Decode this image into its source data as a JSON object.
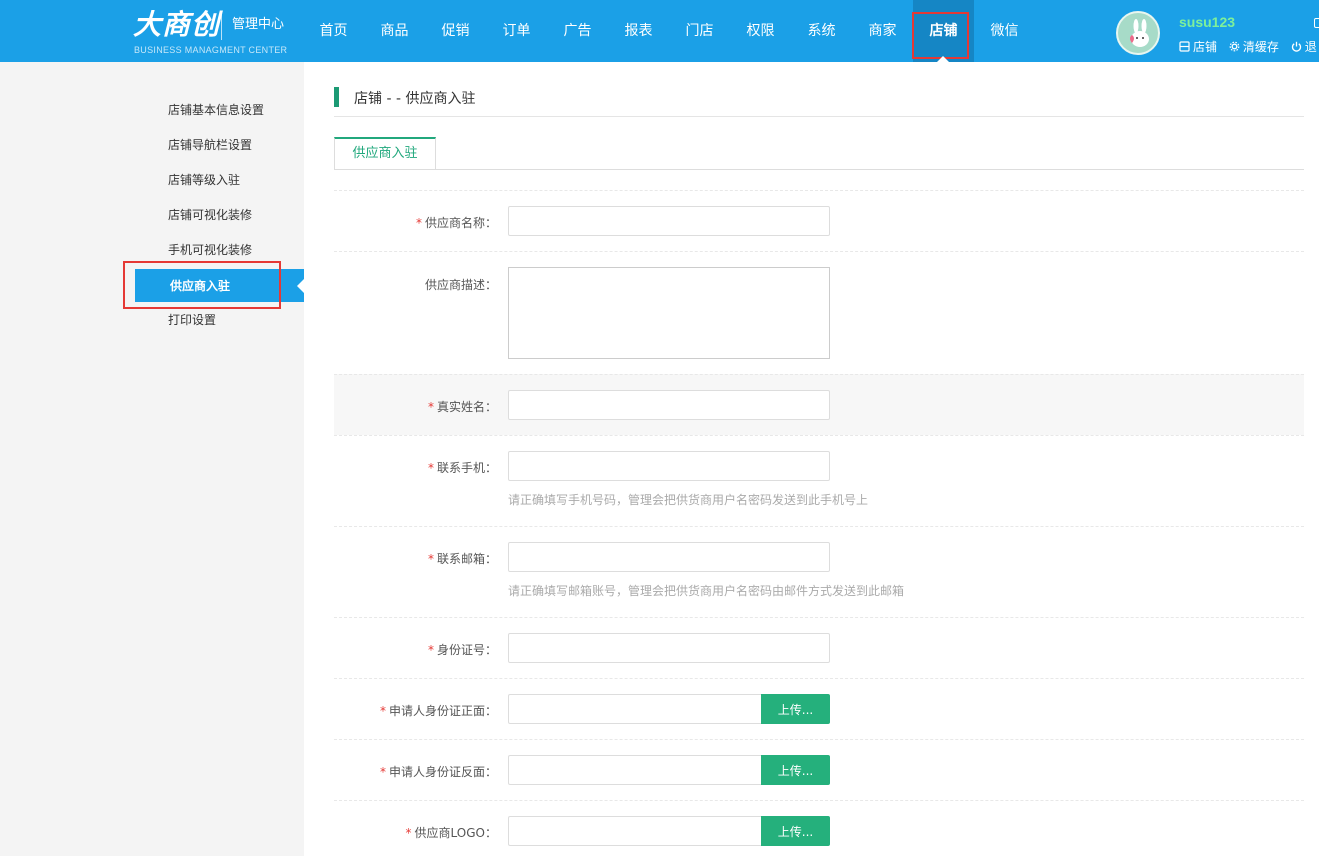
{
  "header": {
    "logo_main": "大商创",
    "logo_sub": "管理中心",
    "logo_en": "BUSINESS MANAGMENT CENTER",
    "nav": [
      "首页",
      "商品",
      "促销",
      "订单",
      "广告",
      "报表",
      "门店",
      "权限",
      "系统",
      "商家",
      "店铺",
      "微信"
    ],
    "active_nav": "店铺",
    "username": "susu123",
    "links": {
      "shop": "店铺",
      "clear_cache": "清缓存",
      "logout": "退"
    }
  },
  "sidebar": {
    "items": [
      "店铺基本信息设置",
      "店铺导航栏设置",
      "店铺等级入驻",
      "店铺可视化装修",
      "手机可视化装修",
      "供应商入驻",
      "打印设置"
    ],
    "active": "供应商入驻"
  },
  "main": {
    "title": "店铺 - - 供应商入驻",
    "tab": "供应商入驻",
    "fields": {
      "supplier_name": "供应商名称：",
      "supplier_desc": "供应商描述：",
      "real_name": "真实姓名：",
      "phone": "联系手机：",
      "phone_hint": "请正确填写手机号码，管理会把供货商用户名密码发送到此手机号上",
      "email": "联系邮箱：",
      "email_hint": "请正确填写邮箱账号，管理会把供货商用户名密码由邮件方式发送到此邮箱",
      "id_number": "身份证号：",
      "id_front": "申请人身份证正面：",
      "id_back": "申请人身份证反面：",
      "logo": "供应商LOGO："
    },
    "required_mark": "*",
    "upload_label": "上传..."
  },
  "colors": {
    "header_bg": "#1ba0e7",
    "accent_green": "#25b07c",
    "required": "#e53935"
  }
}
